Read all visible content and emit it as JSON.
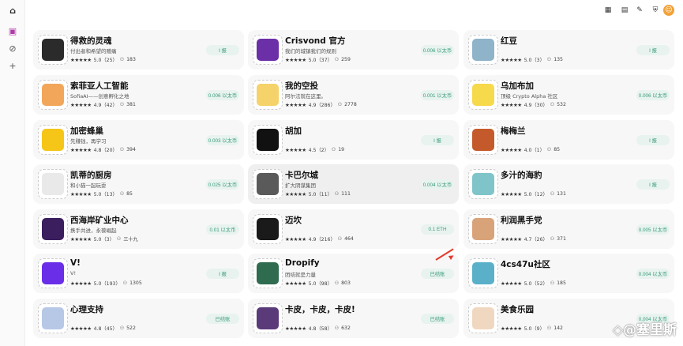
{
  "colors": {
    "accent": "#3a9b7a",
    "button_bg": "#e8f3ef",
    "arrow": "#e23b2e"
  },
  "watermark": "◇@塞里斯",
  "cards": [
    {
      "name": "得救的灵魂",
      "desc": "付出者和希望的赠痛",
      "rating": "5.0（25）",
      "users": "183",
      "price": "I 报",
      "img": "#2b2b2b"
    },
    {
      "name": "Crisvond 官方",
      "desc": "我们的城镇我们的规则",
      "rating": "5.0（37）",
      "users": "259",
      "price": "0.006 以太币",
      "img": "#6b2fa8"
    },
    {
      "name": "红豆",
      "desc": "",
      "rating": "5.0（3）",
      "users": "135",
      "price": "I 报",
      "img": "#8fb3c9"
    },
    {
      "name": "索菲亚人工智能",
      "desc": "SofiaAI——创意孵化之地",
      "rating": "4.9（42）",
      "users": "381",
      "price": "0.006 以太币",
      "img": "#f2a65a"
    },
    {
      "name": "我的空投",
      "desc": "阿尔法就在这里。",
      "rating": "4.9（286）",
      "users": "2778",
      "price": "0.001 以太币",
      "img": "#f5d36a"
    },
    {
      "name": "乌加布加",
      "desc": "顶级 Crypto Alpha 社区",
      "rating": "4.9（30）",
      "users": "532",
      "price": "0.006 以太币",
      "img": "#f7d94c"
    },
    {
      "name": "加密蜂巢",
      "desc": "先赚钱，再学习",
      "rating": "4.8（20）",
      "users": "394",
      "price": "0.003 以太币",
      "img": "#f5c518"
    },
    {
      "name": "胡加",
      "desc": "",
      "rating": "4.5（2）",
      "users": "19",
      "price": "I 报",
      "img": "#111111"
    },
    {
      "name": "梅梅兰",
      "desc": "",
      "rating": "4.0（1）",
      "users": "85",
      "price": "I 报",
      "img": "#c45a2b"
    },
    {
      "name": "凯蒂的厨房",
      "desc": "和小猫一起玩耍",
      "rating": "5.0（13）",
      "users": "85",
      "price": "0.025 以太币",
      "img": "#e9e9e9"
    },
    {
      "name": "卡巴尔城",
      "desc": "扩大阴谋集团",
      "rating": "5.0（11）",
      "users": "111",
      "price": "0.004 以太币",
      "img": "#5a5a5a"
    },
    {
      "name": "多汁的海豹",
      "desc": "",
      "rating": "5.0（12）",
      "users": "131",
      "price": "I 报",
      "img": "#7fc4c9"
    },
    {
      "name": "西海岸矿业中心",
      "desc": "携手共进，永葆崛起",
      "rating": "5.0（3）",
      "users": "三十九",
      "price": "0.01 以太币",
      "img": "#3a1e5e"
    },
    {
      "name": "迈坎",
      "desc": "",
      "rating": "4.9（216）",
      "users": "464",
      "price": "0.1 ETH",
      "img": "#1a1a1a"
    },
    {
      "name": "利润黑手党",
      "desc": "",
      "rating": "4.7（26）",
      "users": "371",
      "price": "0.005 以太币",
      "img": "#d9a37a"
    },
    {
      "name": "V!",
      "desc": "V!",
      "rating": "5.0（193）",
      "users": "1305",
      "price": "I 报",
      "img": "#6a2ee8"
    },
    {
      "name": "Dropify",
      "desc": "团结就是力量",
      "rating": "5.0（98）",
      "users": "803",
      "price": "已结账",
      "img": "#2f6b4f"
    },
    {
      "name": "4cs47u社区",
      "desc": "",
      "rating": "5.0（52）",
      "users": "185",
      "price": "0.004 以太币",
      "img": "#5ab0c9"
    },
    {
      "name": "心理支持",
      "desc": "",
      "rating": "4.8（45）",
      "users": "522",
      "price": "已结账",
      "img": "#b7c8e6"
    },
    {
      "name": "卡皮，卡皮，卡皮!",
      "desc": "",
      "rating": "4.8（58）",
      "users": "632",
      "price": "已结账",
      "img": "#5b3a7a"
    },
    {
      "name": "美食乐园",
      "desc": "",
      "rating": "5.0（9）",
      "users": "142",
      "price": "0.004 以太币",
      "img": "#f0d8c0"
    }
  ]
}
